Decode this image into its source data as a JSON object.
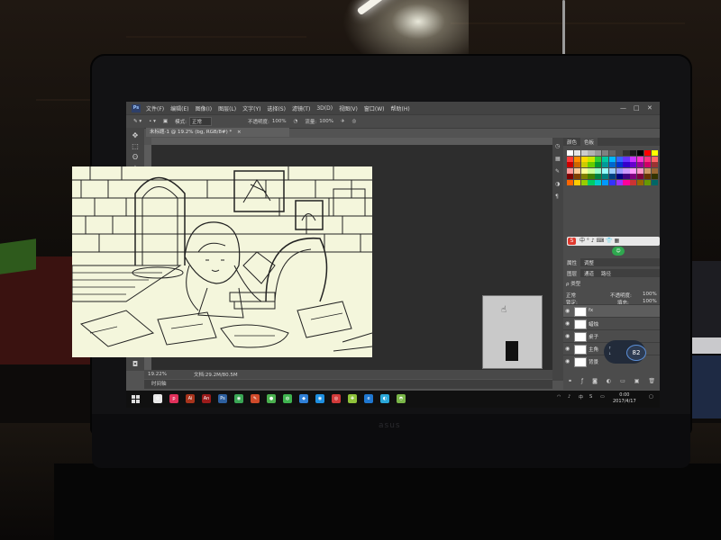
{
  "photoshop": {
    "app_logo": "Ps",
    "menu": [
      "文件(F)",
      "编辑(E)",
      "图像(I)",
      "图层(L)",
      "文字(Y)",
      "选择(S)",
      "滤镜(T)",
      "3D(D)",
      "视图(V)",
      "窗口(W)",
      "帮助(H)"
    ],
    "window_controls": {
      "minimize": "—",
      "maximize": "□",
      "close": "✕"
    },
    "options": {
      "mode_label": "模式:",
      "mode_value": "正常",
      "opacity_label": "不透明度:",
      "opacity_value": "100%",
      "flow_label": "流量:",
      "flow_value": "100%"
    },
    "document_tab": "未标题-1 @ 19.2% (bg, RGB/8#) *",
    "status": {
      "zoom": "19.22%",
      "doc_size": "文档:29.2M/80.5M"
    },
    "timeline_label": "时间轴",
    "panels": {
      "top_tabs": [
        "颜色",
        "色板"
      ],
      "properties_tabs": [
        "属性",
        "调整"
      ],
      "layer_tabs": [
        "图层",
        "通道",
        "路径"
      ],
      "filter_label": "ρ 类型",
      "blend_mode": "正常",
      "opacity_label": "不透明度:",
      "opacity_value": "100%",
      "fill_label": "填充:",
      "fill_value": "100%",
      "lock_label": "锁定:"
    },
    "layers": [
      {
        "name": "fx",
        "selected": true
      },
      {
        "name": "蜡烛"
      },
      {
        "name": "桌子"
      },
      {
        "name": "主角"
      },
      {
        "name": "背景"
      }
    ],
    "ime_badge": "S",
    "net_widget_value": "82",
    "swatch_colors": [
      "#ffffff",
      "#e6e6e6",
      "#cccccc",
      "#b3b3b3",
      "#999999",
      "#808080",
      "#666666",
      "#4d4d4d",
      "#333333",
      "#1a1a1a",
      "#000000",
      "#ff0000",
      "#ffff00",
      "#ff3b3b",
      "#ff8c00",
      "#ffd700",
      "#c8e600",
      "#33cc33",
      "#00c8a0",
      "#00b7ff",
      "#3366ff",
      "#6633ff",
      "#cc33ff",
      "#ff33cc",
      "#ff3380",
      "#ff6666",
      "#cc0000",
      "#cc6600",
      "#cccc00",
      "#66cc00",
      "#009933",
      "#009999",
      "#0066cc",
      "#0033cc",
      "#3300cc",
      "#6600cc",
      "#990099",
      "#cc0066",
      "#993333",
      "#ff9999",
      "#ffcc99",
      "#ffff99",
      "#ccff99",
      "#99ffcc",
      "#99ffff",
      "#99ccff",
      "#9999ff",
      "#cc99ff",
      "#ff99ff",
      "#ff99cc",
      "#cc9966",
      "#996633",
      "#800000",
      "#804000",
      "#808000",
      "#408000",
      "#008040",
      "#008080",
      "#004080",
      "#000080",
      "#400080",
      "#800080",
      "#800040",
      "#663300",
      "#333300",
      "#ff6600",
      "#ffcc00",
      "#99cc00",
      "#00cc66",
      "#00cccc",
      "#0099ff",
      "#3333ff",
      "#9933ff",
      "#ff0099",
      "#cc3333",
      "#996600",
      "#669900",
      "#006666"
    ]
  },
  "taskbar": {
    "clock_time": "0:00",
    "clock_date": "2017/4/17",
    "apps": [
      {
        "name": "app-pinwheel",
        "color": "#e8e8e8",
        "glyph": "✿"
      },
      {
        "name": "app-p",
        "color": "#e0305a",
        "glyph": "p"
      },
      {
        "name": "app-illustrator",
        "color": "#a8341c",
        "glyph": "Ai"
      },
      {
        "name": "app-animate",
        "color": "#9b1b1b",
        "glyph": "An"
      },
      {
        "name": "app-photoshop",
        "color": "#2d5f9e",
        "glyph": "Ps"
      },
      {
        "name": "app-chrome",
        "color": "#3aa655",
        "glyph": "◉"
      },
      {
        "name": "app-tool",
        "color": "#d04a2a",
        "glyph": "✎"
      },
      {
        "name": "app-green",
        "color": "#4bb04f",
        "glyph": "●"
      },
      {
        "name": "app-wechat",
        "color": "#3fb34f",
        "glyph": "◍"
      },
      {
        "name": "app-blue",
        "color": "#2f7fd6",
        "glyph": "◆"
      },
      {
        "name": "app-qq",
        "color": "#1e8fe0",
        "glyph": "◉"
      },
      {
        "name": "app-netease",
        "color": "#d23a3a",
        "glyph": "◎"
      },
      {
        "name": "app-security",
        "color": "#8fc23a",
        "glyph": "✚"
      },
      {
        "name": "app-edge",
        "color": "#1f77d0",
        "glyph": "e"
      },
      {
        "name": "app-browser",
        "color": "#2aa7d8",
        "glyph": "◐"
      },
      {
        "name": "app-360",
        "color": "#7ab648",
        "glyph": "◓"
      }
    ]
  }
}
